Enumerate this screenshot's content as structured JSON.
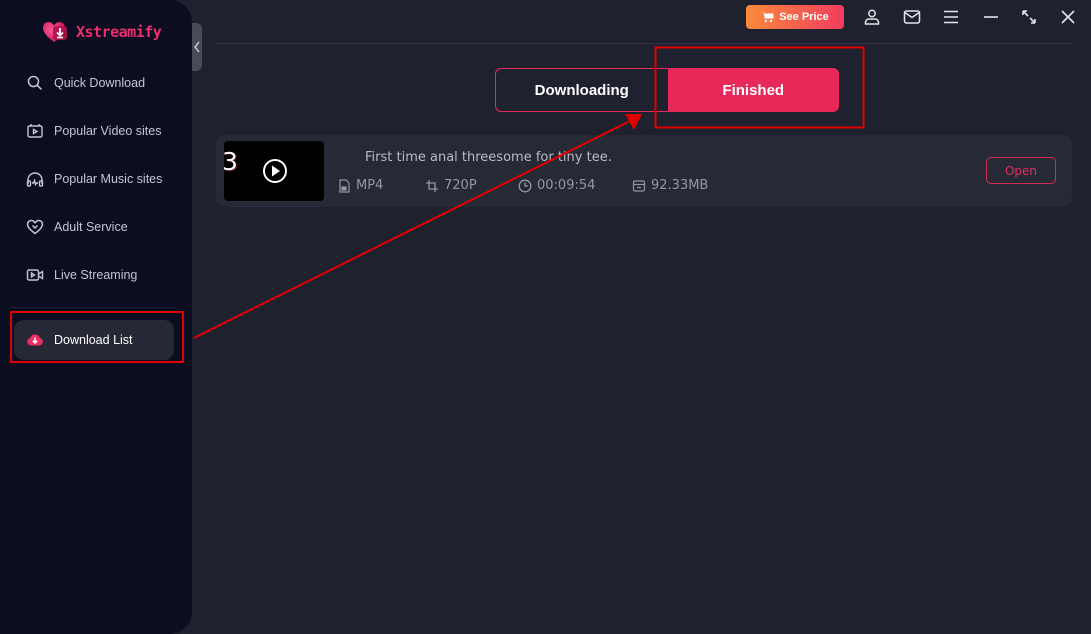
{
  "app": {
    "name": "Xstreamify",
    "brand_color": "#ee2d6f"
  },
  "sidebar": {
    "items": [
      {
        "label": "Quick Download",
        "icon": "search-icon",
        "active": false
      },
      {
        "label": "Popular Video sites",
        "icon": "video-site-icon",
        "active": false
      },
      {
        "label": "Popular Music sites",
        "icon": "headphones-icon",
        "active": false
      },
      {
        "label": "Adult Service",
        "icon": "heart-icon",
        "active": false
      },
      {
        "label": "Live Streaming",
        "icon": "live-camera-icon",
        "active": false
      },
      {
        "label": "Download List",
        "icon": "cloud-download-icon",
        "active": true
      }
    ]
  },
  "topbar": {
    "see_price_label": "See Price",
    "icons": [
      "account-icon",
      "mail-icon",
      "menu-icon",
      "minimize-icon",
      "maximize-icon",
      "close-icon"
    ]
  },
  "tabs": [
    {
      "label": "Downloading",
      "active": false
    },
    {
      "label": "Finished",
      "active": true
    }
  ],
  "downloads": [
    {
      "thumbnail_text": "3",
      "title": "First time anal threesome for tiny tee.",
      "format": "MP4",
      "resolution": "720P",
      "duration": "00:09:54",
      "size": "92.33MB",
      "action_label": "Open"
    }
  ],
  "colors": {
    "accent": "#e9285a",
    "annotation": "#e00000",
    "sidebar_bg": "#0c0d21",
    "main_bg": "#20212f"
  }
}
